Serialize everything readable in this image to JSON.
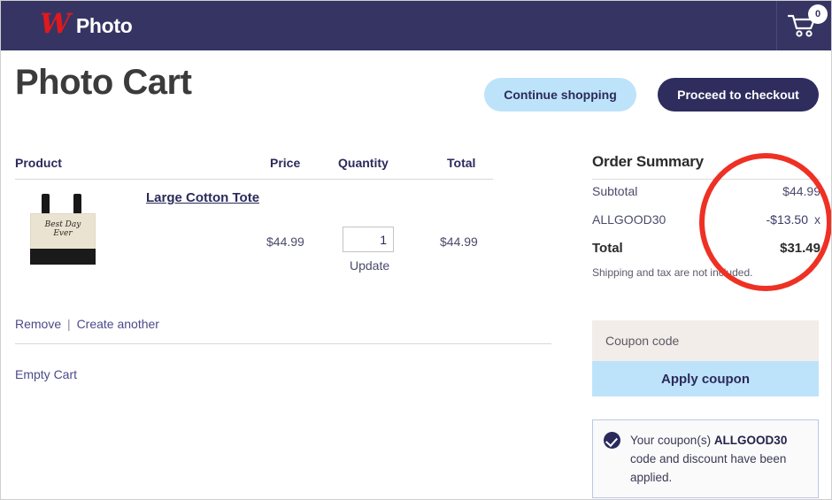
{
  "header": {
    "brand_mark": "W",
    "brand_name": "Photo",
    "cart_icon": "shopping-cart-icon",
    "cart_count": "0"
  },
  "page": {
    "title": "Photo Cart",
    "continue_label": "Continue shopping",
    "checkout_label": "Proceed to checkout"
  },
  "cart_table": {
    "columns": {
      "product": "Product",
      "price": "Price",
      "quantity": "Quantity",
      "total": "Total"
    },
    "item": {
      "name": "Large Cotton Tote",
      "thumb_text_line1": "Best Day",
      "thumb_text_line2": "Ever",
      "price": "$44.99",
      "quantity": "1",
      "update_label": "Update",
      "total": "$44.99",
      "remove_label": "Remove",
      "separator": "|",
      "create_another_label": "Create another"
    },
    "empty_cart_label": "Empty Cart"
  },
  "order_summary": {
    "title": "Order Summary",
    "rows": [
      {
        "label": "Subtotal",
        "value": "$44.99"
      },
      {
        "label": "ALLGOOD30",
        "value": "-$13.50",
        "remove": "x"
      },
      {
        "label": "Total",
        "value": "$31.49"
      }
    ],
    "note": "Shipping and tax are not included."
  },
  "coupon": {
    "placeholder": "Coupon code",
    "value": "",
    "apply_label": "Apply coupon"
  },
  "notice": {
    "icon": "check-circle-icon",
    "prefix": "Your coupon(s) ",
    "code": "ALLGOOD30",
    "suffix": " code and discount have been applied."
  },
  "annotation": {
    "shape": "red-ellipse-highlight",
    "color": "#ee3124"
  },
  "colors": {
    "header_bg": "#363463",
    "brand_red": "#e1191d",
    "accent_light_blue": "#bde3fa",
    "accent_navy": "#2e2d5e",
    "coupon_field_bg": "#f2ede8"
  }
}
